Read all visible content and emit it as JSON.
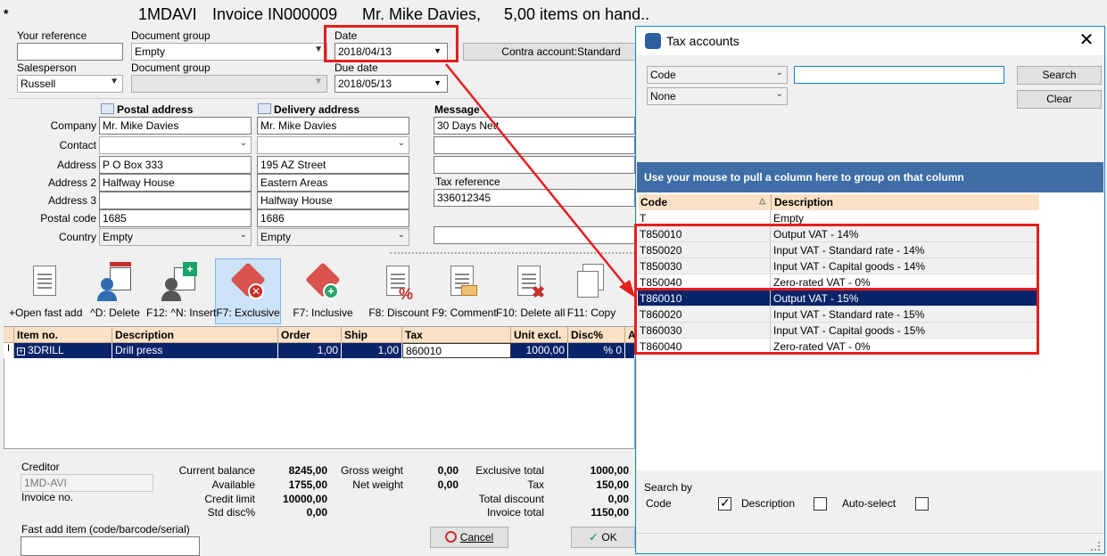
{
  "header": {
    "marker": "*",
    "account_code": "1MDAVI",
    "invoice_title": "Invoice IN000009",
    "customer_name": "Mr. Mike Davies,",
    "items_on_hand": "5,00 items on hand.."
  },
  "form": {
    "your_reference_label": "Your reference",
    "your_reference_value": "",
    "document_group_label": "Document group",
    "document_group_value": "Empty",
    "document_group2_label": "Document group",
    "document_group2_value": "",
    "date_label": "Date",
    "date_value": "2018/04/13",
    "due_date_label": "Due date",
    "due_date_value": "2018/05/13",
    "contra_account_button": "Contra account:Standard",
    "salesperson_label": "Salesperson",
    "salesperson_value": "Russell"
  },
  "address": {
    "postal_header": "Postal address",
    "delivery_header": "Delivery address",
    "message_header": "Message",
    "labels": [
      "Company",
      "Contact",
      "Address",
      "Address 2",
      "Address 3",
      "Postal code",
      "Country"
    ],
    "postal": [
      "Mr. Mike Davies",
      "",
      "P O Box 333",
      "Halfway House",
      "",
      "1685",
      "Empty"
    ],
    "delivery": [
      "Mr. Mike Davies",
      "",
      "195 AZ Street",
      "Eastern Areas",
      "Halfway House",
      "1686",
      "Empty"
    ],
    "message_line1": "30 Days Nett",
    "tax_reference_label": "Tax reference",
    "tax_reference_value": "336012345"
  },
  "toolbar": [
    {
      "label": "+Open fast add",
      "icon": "open-fast-add-icon"
    },
    {
      "label": "^D: Delete",
      "icon": "delete-line-icon"
    },
    {
      "label": "F12: ^N: Insert",
      "icon": "insert-line-icon"
    },
    {
      "label": "F7: Exclusive",
      "icon": "exclusive-tag-icon"
    },
    {
      "label": "F7: Inclusive",
      "icon": "inclusive-tag-icon"
    },
    {
      "label": "F8: Discount",
      "icon": "discount-icon"
    },
    {
      "label": "F9: Comment",
      "icon": "comment-icon"
    },
    {
      "label": "F10: Delete all",
      "icon": "delete-all-icon"
    },
    {
      "label": "F11: Copy",
      "icon": "copy-icon"
    }
  ],
  "grid": {
    "headers": [
      "Item no.",
      "Description",
      "Order",
      "Ship",
      "Tax",
      "Unit excl.",
      "Disc%",
      "A"
    ],
    "row": {
      "item": "3DRILL",
      "description": "Drill press",
      "order": "1,00",
      "ship": "1,00",
      "tax": "860010",
      "unit_excl": "1000,00",
      "disc": "% 0"
    }
  },
  "footer": {
    "creditor_label": "Creditor",
    "creditor_value": "1MD-AVI",
    "invoice_no_label": "Invoice no.",
    "fast_add_label": "Fast add item (code/barcode/serial)",
    "current_balance_label": "Current balance",
    "current_balance": "8245,00",
    "available_label": "Available",
    "available": "1755,00",
    "credit_limit_label": "Credit limit",
    "credit_limit": "10000,00",
    "std_disc_label": "Std disc%",
    "std_disc": "0,00",
    "gross_weight_label": "Gross weight",
    "gross_weight": "0,00",
    "net_weight_label": "Net weight",
    "net_weight": "0,00",
    "exclusive_total_label": "Exclusive total",
    "exclusive_total": "1000,00",
    "tax_label": "Tax",
    "tax": "150,00",
    "total_discount_label": "Total discount",
    "total_discount": "0,00",
    "invoice_total_label": "Invoice total",
    "invoice_total": "1150,00",
    "cancel_label": "Cancel",
    "ok_label": "OK"
  },
  "tax_dialog": {
    "title": "Tax accounts",
    "field_select": "Code",
    "filter_select": "None",
    "search_value": "",
    "search_button": "Search",
    "clear_button": "Clear",
    "group_hint": "Use your mouse to pull a column here to group on that column",
    "col_code": "Code",
    "col_description": "Description",
    "rows": [
      {
        "code": "T",
        "description": "Empty"
      },
      {
        "code": "T850010",
        "description": "Output VAT - 14%"
      },
      {
        "code": "T850020",
        "description": "Input VAT - Standard rate - 14%"
      },
      {
        "code": "T850030",
        "description": "Input VAT - Capital goods - 14%"
      },
      {
        "code": "T850040",
        "description": "Zero-rated  VAT - 0%"
      },
      {
        "code": "T860010",
        "description": "Output VAT -  15%"
      },
      {
        "code": "T860020",
        "description": "Input VAT - Standard rate - 15%"
      },
      {
        "code": "T860030",
        "description": "Input VAT - Capital goods - 15%"
      },
      {
        "code": "T860040",
        "description": "Zero-rated  VAT - 0%"
      }
    ],
    "selected_row": 5,
    "search_by_label": "Search by",
    "opt_code": "Code",
    "opt_description": "Description",
    "opt_autoselect": "Auto-select",
    "code_checked": true,
    "description_checked": false,
    "autoselect_checked": false
  },
  "colors": {
    "highlight": "#e41e1e",
    "selection": "#0a246a",
    "group_panel": "#3e6ea5",
    "grid_header": "#fbe1c5"
  }
}
